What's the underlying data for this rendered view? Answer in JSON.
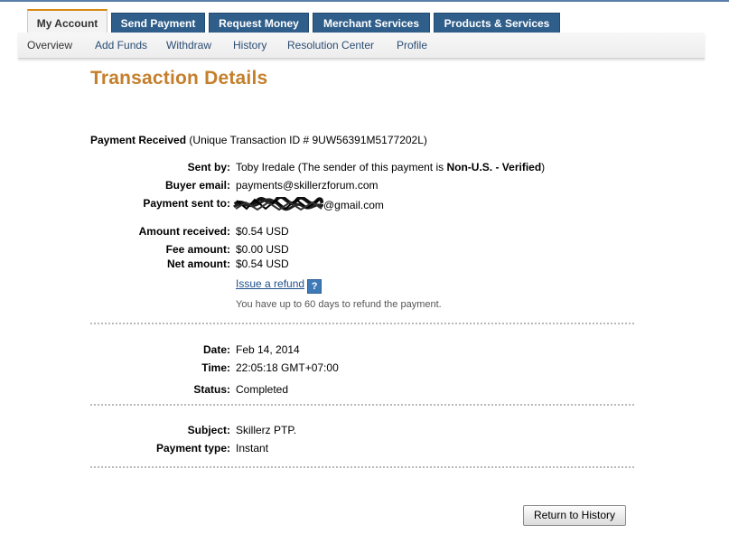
{
  "main_tabs": [
    {
      "label": "My Account",
      "active": true
    },
    {
      "label": "Send Payment",
      "active": false
    },
    {
      "label": "Request Money",
      "active": false
    },
    {
      "label": "Merchant Services",
      "active": false
    },
    {
      "label": "Products & Services",
      "active": false
    }
  ],
  "sub_nav": [
    {
      "label": "Overview",
      "active": true
    },
    {
      "label": "Add Funds",
      "active": false
    },
    {
      "label": "Withdraw",
      "active": false
    },
    {
      "label": "History",
      "active": false
    },
    {
      "label": "Resolution Center",
      "active": false
    },
    {
      "label": "Profile",
      "active": false
    }
  ],
  "page": {
    "title": "Transaction Details",
    "summary_label": "Payment Received",
    "summary_detail": "(Unique Transaction ID # 9UW56391M5177202L)"
  },
  "details": {
    "sent_by": {
      "label": "Sent by:",
      "name": "Toby Iredale",
      "note_prefix": "(The sender of this payment is",
      "status": "Non-U.S. - Verified",
      "note_suffix": ")"
    },
    "buyer_email": {
      "label": "Buyer email:",
      "value": "payments@skillerzforum.com"
    },
    "payment_sent_to": {
      "label": "Payment sent to:",
      "value_suffix": "@gmail.com"
    },
    "amount_received": {
      "label": "Amount received:",
      "value": "$0.54 USD"
    },
    "fee_amount": {
      "label": "Fee amount:",
      "value": "$0.00 USD"
    },
    "net_amount": {
      "label": "Net amount:",
      "value": "$0.54 USD"
    },
    "refund": {
      "link": "Issue a refund",
      "help": "?",
      "note": "You have up to 60 days to refund the payment."
    },
    "date": {
      "label": "Date:",
      "value": "Feb 14, 2014"
    },
    "time": {
      "label": "Time:",
      "value": "22:05:18 GMT+07:00"
    },
    "status": {
      "label": "Status:",
      "value": "Completed"
    },
    "subject": {
      "label": "Subject:",
      "value": "Skillerz PTP."
    },
    "payment_type": {
      "label": "Payment type:",
      "value": "Instant"
    }
  },
  "actions": {
    "return_label": "Return to History"
  },
  "icons": {
    "help": "question-mark-icon"
  },
  "colors": {
    "tab_blue": "#2f5e8a",
    "tab_active_accent": "#d88a12",
    "title_orange": "#c47f2c",
    "link_blue": "#1f4e8a"
  }
}
